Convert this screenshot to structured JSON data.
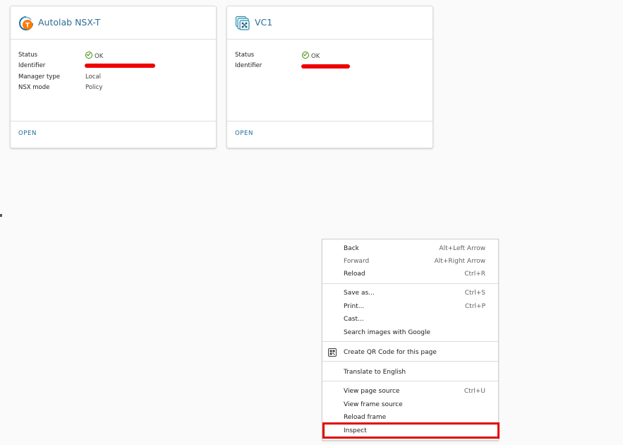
{
  "cards": [
    {
      "title": "Autolab NSX-T",
      "icon": "nsx-t-icon",
      "rows": [
        {
          "key": "Status",
          "value": "OK"
        },
        {
          "key": "Identifier",
          "value": ""
        },
        {
          "key": "Manager type",
          "value": "Local"
        },
        {
          "key": "NSX mode",
          "value": "Policy"
        }
      ],
      "action": "OPEN"
    },
    {
      "title": "VC1",
      "icon": "vcenter-icon",
      "rows": [
        {
          "key": "Status",
          "value": "OK"
        },
        {
          "key": "Identifier",
          "value": ""
        }
      ],
      "action": "OPEN"
    }
  ],
  "context_menu": {
    "items": [
      {
        "label": "Back",
        "shortcut": "Alt+Left Arrow"
      },
      {
        "label": "Forward",
        "shortcut": "Alt+Right Arrow"
      },
      {
        "label": "Reload",
        "shortcut": "Ctrl+R"
      },
      {
        "label": "Save as...",
        "shortcut": "Ctrl+S"
      },
      {
        "label": "Print...",
        "shortcut": "Ctrl+P"
      },
      {
        "label": "Cast...",
        "shortcut": ""
      },
      {
        "label": "Search images with Google",
        "shortcut": ""
      },
      {
        "label": "Create QR Code for this page",
        "shortcut": ""
      },
      {
        "label": "Translate to English",
        "shortcut": ""
      },
      {
        "label": "View page source",
        "shortcut": "Ctrl+U"
      },
      {
        "label": "View frame source",
        "shortcut": ""
      },
      {
        "label": "Reload frame",
        "shortcut": ""
      },
      {
        "label": "Inspect",
        "shortcut": ""
      }
    ]
  },
  "colors": {
    "accent": "#2d6e97",
    "ok_green": "#3c8b00",
    "redaction": "#ee0000",
    "highlight": "#e30000"
  }
}
